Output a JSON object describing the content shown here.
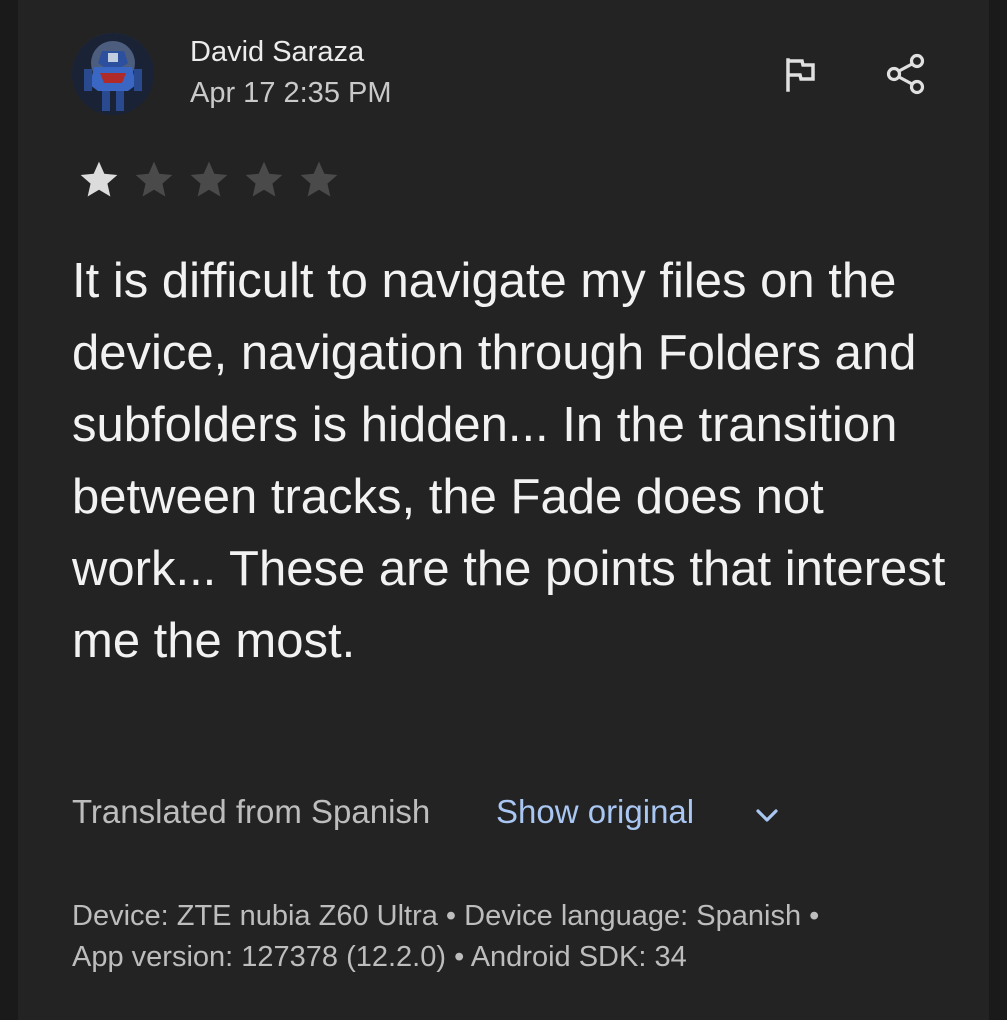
{
  "review": {
    "author": "David Saraza",
    "date": "Apr 17 2:35 PM",
    "rating": 1,
    "max_rating": 5,
    "text": "It is difficult to navigate my files on the device, navigation through Folders and subfolders is hidden... In the transition between tracks, the Fade does not work... These are the points that interest me the most.",
    "translated_label": "Translated from Spanish",
    "show_original_label": "Show original",
    "device_info_line1": "Device: ZTE nubia Z60 Ultra • Device language: Spanish •",
    "device_info_line2": "App version: 127378 (12.2.0) • Android SDK: 34"
  },
  "icons": {
    "flag": "flag-icon",
    "share": "share-icon",
    "chevron": "chevron-down-icon"
  },
  "colors": {
    "background": "#232323",
    "star_filled": "#dcdcdc",
    "star_empty": "#4a4a4a",
    "link": "#a9c7f2"
  }
}
